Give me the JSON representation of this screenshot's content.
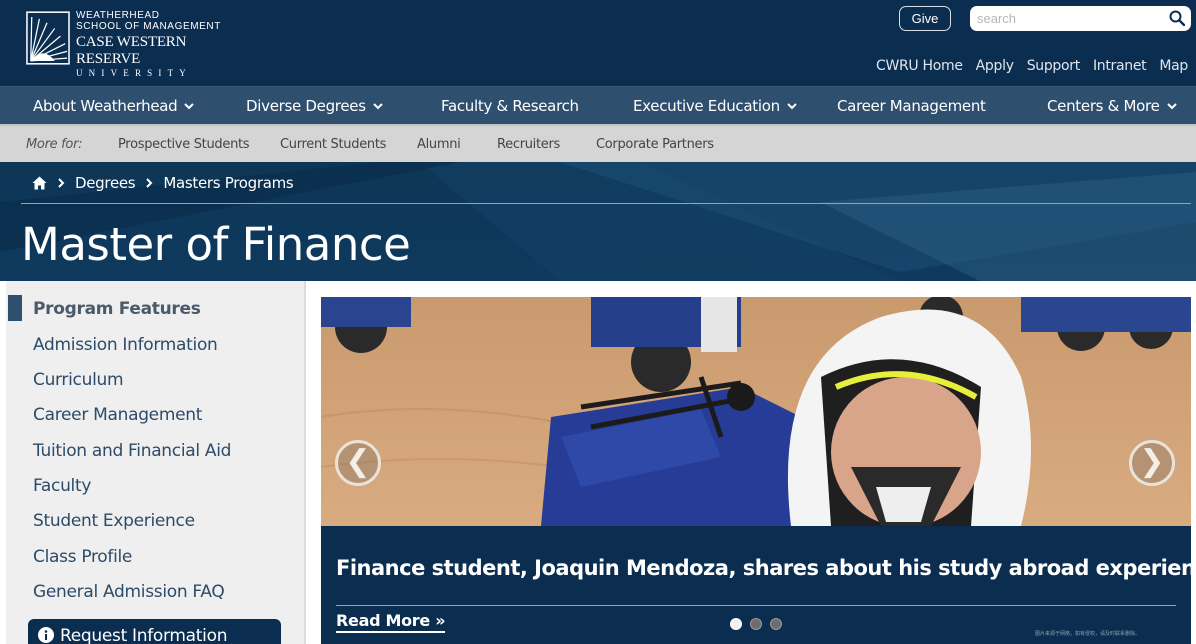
{
  "header": {
    "logo": {
      "line1": "WEATHERHEAD",
      "line2": "SCHOOL OF MANAGEMENT",
      "line3": "CASE WESTERN RESERVE",
      "line4": "UNIVERSITY"
    },
    "give_label": "Give",
    "search_placeholder": "search",
    "util_links": [
      "CWRU Home",
      "Apply",
      "Support",
      "Intranet",
      "Map"
    ]
  },
  "main_nav": [
    {
      "label": "About Weatherhead",
      "dropdown": true
    },
    {
      "label": "Diverse Degrees",
      "dropdown": true
    },
    {
      "label": "Faculty & Research",
      "dropdown": false
    },
    {
      "label": "Executive Education",
      "dropdown": true
    },
    {
      "label": "Career Management",
      "dropdown": false
    },
    {
      "label": "Centers & More",
      "dropdown": true
    }
  ],
  "sub_nav": {
    "label": "More for:",
    "links": [
      "Prospective Students",
      "Current Students",
      "Alumni",
      "Recruiters",
      "Corporate Partners"
    ]
  },
  "breadcrumb": [
    "Degrees",
    "Masters Programs"
  ],
  "page_title": "Master of Finance",
  "sidebar": {
    "items": [
      "Program Features",
      "Admission Information",
      "Curriculum",
      "Career Management",
      "Tuition and Financial Aid",
      "Faculty",
      "Student Experience",
      "Class Profile",
      "General Admission FAQ"
    ],
    "active_index": 0,
    "request_label": "Request Information"
  },
  "carousel": {
    "caption": "Finance student, Joaquin Mendoza, shares about his study abroad experience in Spain",
    "read_more": "Read More »",
    "prev_glyph": "❮",
    "next_glyph": "❯",
    "slide_count": 3,
    "active_slide": 0,
    "watermark": "图片来源于网络，如有侵权，请及时联系删除。"
  },
  "colors": {
    "header_bg": "#0b2d4f",
    "nav_bg": "#2f4f6e",
    "subnav_bg": "#d5d5d5",
    "sidebar_bg": "#efefef",
    "link_color": "#2d4b68"
  }
}
